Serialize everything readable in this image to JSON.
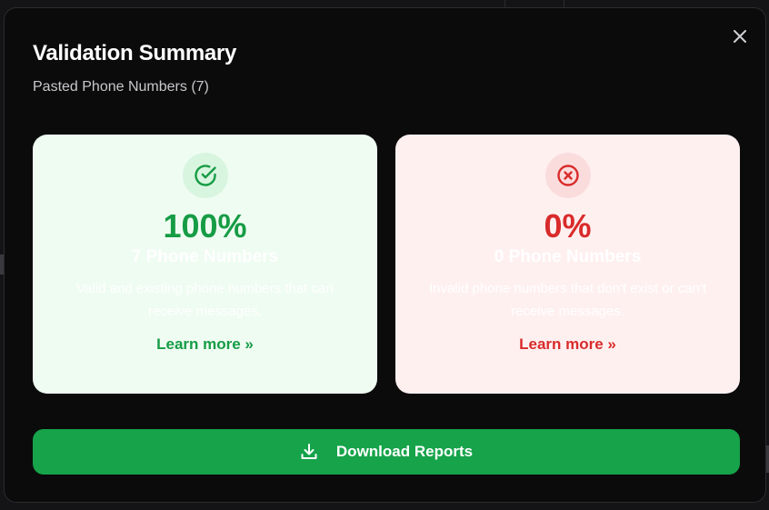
{
  "modal": {
    "title": "Validation Summary",
    "subtitle": "Pasted Phone Numbers (7)",
    "close_icon": "close-icon"
  },
  "cards": {
    "valid": {
      "icon": "check-circle-icon",
      "percent": "100%",
      "count": "7 Phone Numbers",
      "description": "Valid and existing phone numbers that can receive messages.",
      "link": "Learn more »",
      "color": "#169c45"
    },
    "invalid": {
      "icon": "x-circle-icon",
      "percent": "0%",
      "count": "0 Phone Numbers",
      "description": "Invalid phone numbers that don't exist or can't receive messages.",
      "link": "Learn more »",
      "color": "#d92b2b"
    }
  },
  "actions": {
    "download_label": "Download Reports",
    "download_icon": "download-icon",
    "color": "#16a34a"
  }
}
